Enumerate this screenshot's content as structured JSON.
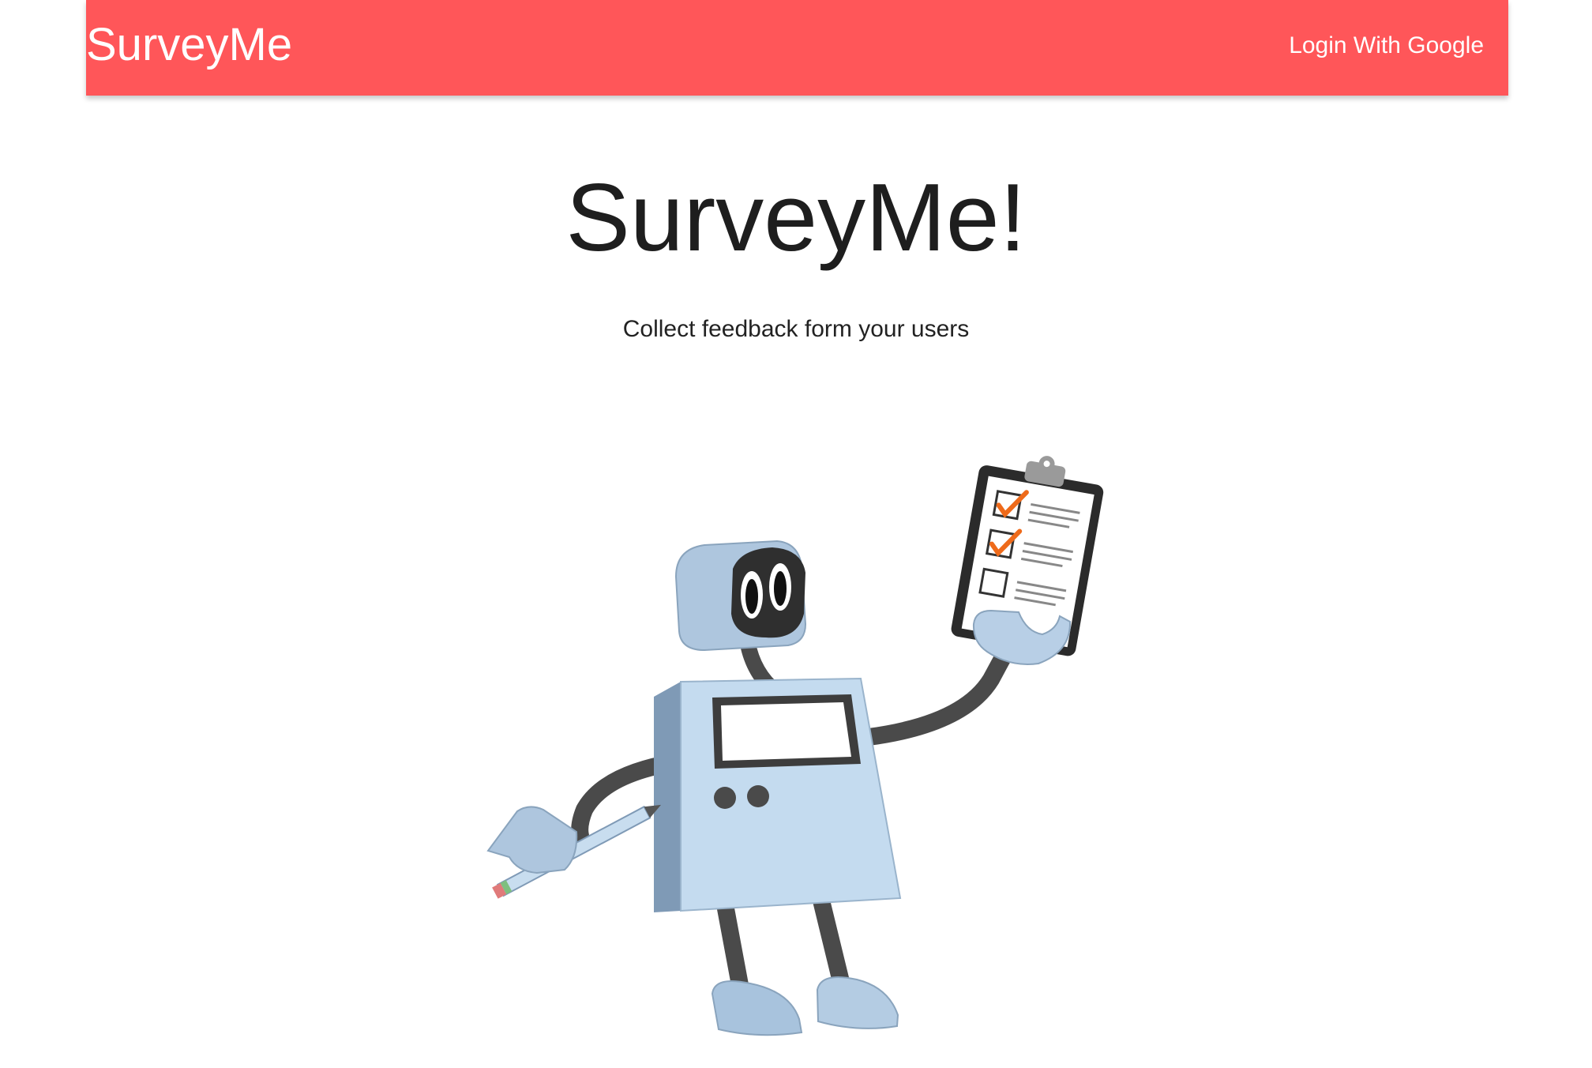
{
  "navbar": {
    "brand": "SurveyMe",
    "login_label": "Login With Google"
  },
  "hero": {
    "title": "SurveyMe!",
    "subtitle": "Collect feedback form your users"
  },
  "illustration": {
    "icon": "robot-with-clipboard-illustration"
  },
  "colors": {
    "navbar_bg": "#ff5659",
    "navbar_text": "#ffffff",
    "title_text": "#1e1e1e"
  }
}
